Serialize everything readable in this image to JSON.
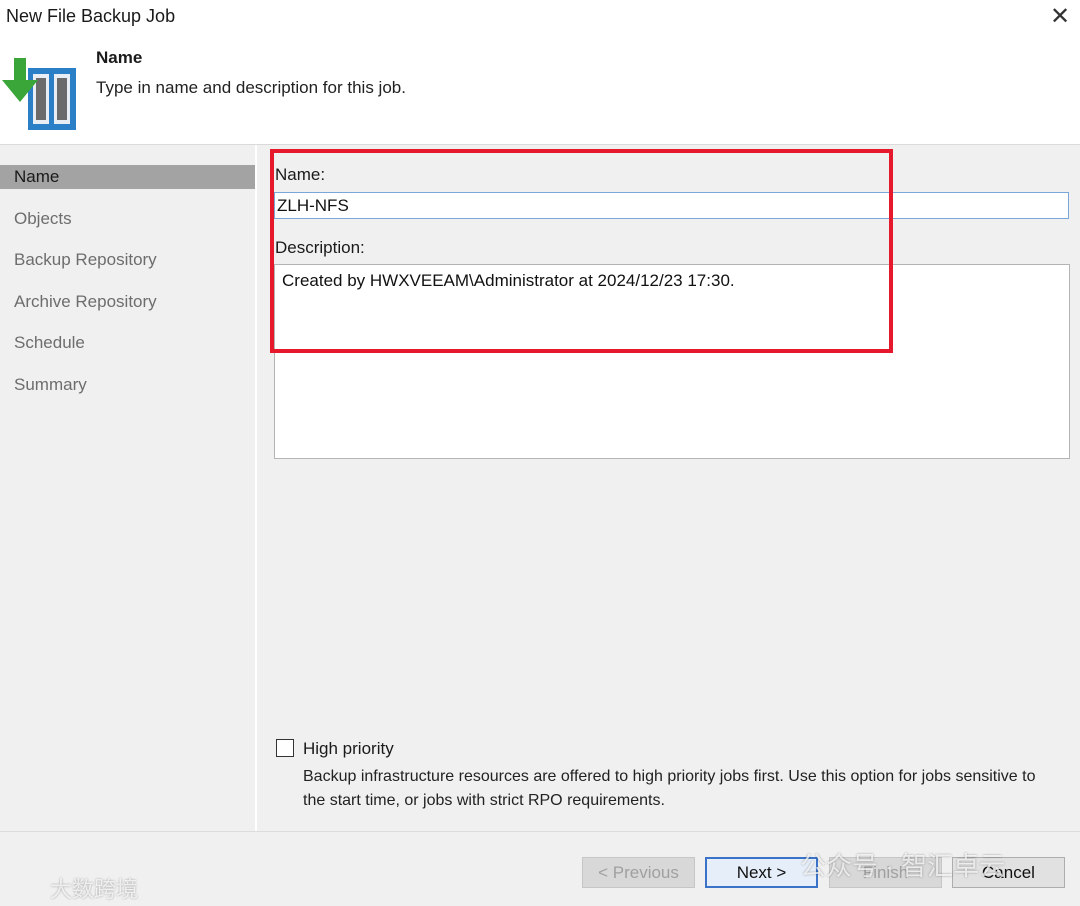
{
  "window": {
    "title": "New File Backup Job"
  },
  "header": {
    "title": "Name",
    "subtitle": "Type in name and description for this job."
  },
  "sidebar": {
    "items": [
      {
        "label": "Name"
      },
      {
        "label": "Objects"
      },
      {
        "label": "Backup Repository"
      },
      {
        "label": "Archive Repository"
      },
      {
        "label": "Schedule"
      },
      {
        "label": "Summary"
      }
    ],
    "active": "Name"
  },
  "form": {
    "name_label": "Name:",
    "name_value": "ZLH-NFS",
    "description_label": "Description:",
    "description_value": "Created by HWXVEEAM\\Administrator at 2024/12/23 17:30.",
    "high_priority_label": "High priority",
    "high_priority_checked": false,
    "high_priority_desc": "Backup infrastructure resources are offered to high priority jobs first. Use this option for jobs sensitive to the start time, or jobs with strict RPO requirements."
  },
  "buttons": {
    "previous": "< Previous",
    "next": "Next >",
    "finish": "Finish",
    "cancel": "Cancel"
  },
  "watermarks": {
    "left": "大数跨境",
    "right": "公众号 · 智汇卓云"
  },
  "colors": {
    "highlight": "#e5192b",
    "sidebar_active": "#a3a3a3",
    "default_button_border": "#3b73c9"
  }
}
